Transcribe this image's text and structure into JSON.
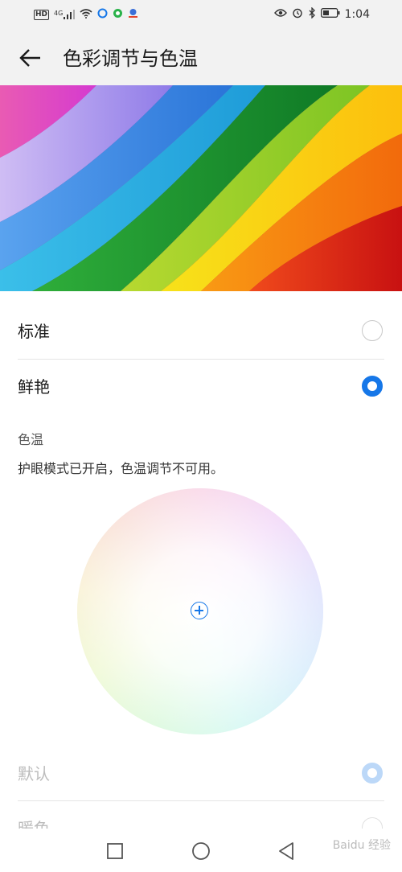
{
  "status_bar": {
    "left_icons": [
      "hd-icon",
      "signal-4g-icon",
      "wifi-icon",
      "app-icon-1",
      "app-icon-2",
      "app-icon-3"
    ],
    "hd_label": "HD",
    "network_label": "4G",
    "time": "1:04",
    "right_icons": [
      "eye-icon",
      "alarm-icon",
      "bluetooth-icon",
      "battery-icon"
    ]
  },
  "app_bar": {
    "title": "色彩调节与色温"
  },
  "color_modes": [
    {
      "label": "标准",
      "selected": false
    },
    {
      "label": "鲜艳",
      "selected": true
    }
  ],
  "temperature": {
    "section_title": "色温",
    "note": "护眼模式已开启，色温调节不可用。"
  },
  "temperature_options": [
    {
      "label": "默认",
      "selected": true,
      "enabled": false
    },
    {
      "label": "暖色",
      "selected": false,
      "enabled": false
    }
  ],
  "nav": {
    "buttons": [
      "recent-apps",
      "home",
      "back"
    ]
  },
  "watermark": "Baidu 经验"
}
